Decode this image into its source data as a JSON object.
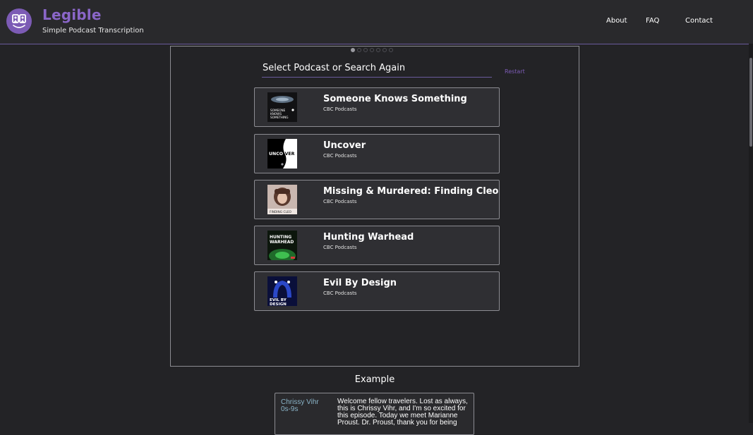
{
  "header": {
    "title": "Legible",
    "subtitle": "Simple Podcast Transcription",
    "logo_icon": "book-reader-icon",
    "nav": [
      {
        "label": "About"
      },
      {
        "label": "FAQ"
      },
      {
        "label": "Contact"
      }
    ]
  },
  "colors": {
    "accent": "#7c5bb5",
    "background": "#232326",
    "card": "#2f2f33",
    "speaker": "#8ab4c8"
  },
  "carousel": {
    "total_steps": 7,
    "active_step": 1
  },
  "search": {
    "placeholder": "Select Podcast or Search Again",
    "restart_label": "Restart"
  },
  "podcasts": [
    {
      "title": "Someone Knows Something",
      "author": "CBC Podcasts",
      "art_text": "SOMEONE KNOWS SOMETHING"
    },
    {
      "title": "Uncover",
      "author": "CBC Podcasts",
      "art_text": "UNCOVER"
    },
    {
      "title": "Missing & Murdered: Finding Cleo",
      "author": "CBC Podcasts",
      "art_text": "FINDING CLEO"
    },
    {
      "title": "Hunting Warhead",
      "author": "CBC Podcasts",
      "art_text": "HUNTING WARHEAD"
    },
    {
      "title": "Evil By Design",
      "author": "CBC Podcasts",
      "art_text": "EVIL BY DESIGN"
    }
  ],
  "example": {
    "heading": "Example",
    "speaker": "Chrissy Vihr",
    "time": "0s-9s",
    "text": "Welcome fellow travelers. Lost as always, this is Chrissy Vihr, and I'm so excited for this episode. Today we meet Marianne Proust. Dr. Proust, thank you for being"
  }
}
